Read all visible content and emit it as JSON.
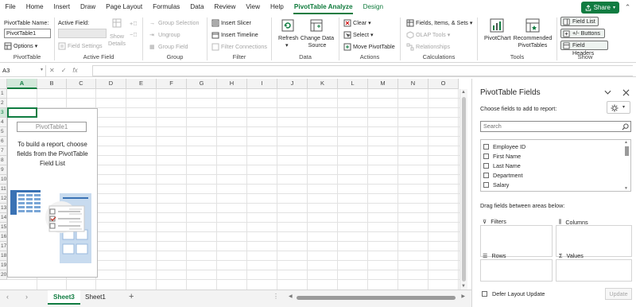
{
  "menu": {
    "tabs": [
      "File",
      "Home",
      "Insert",
      "Draw",
      "Page Layout",
      "Formulas",
      "Data",
      "Review",
      "View",
      "Help",
      "PivotTable Analyze",
      "Design"
    ],
    "active": "PivotTable Analyze",
    "share": "Share"
  },
  "ribbon": {
    "pivottable": {
      "name_label": "PivotTable Name:",
      "name_value": "PivotTable1",
      "options": "Options",
      "group": "PivotTable"
    },
    "active_field": {
      "label": "Active Field:",
      "show_details": "Show Details",
      "field_settings": "Field Settings",
      "group": "Active Field"
    },
    "group": {
      "selection": "Group Selection",
      "ungroup": "Ungroup",
      "field": "Group Field",
      "group": "Group"
    },
    "filter": {
      "slicer": "Insert Slicer",
      "timeline": "Insert Timeline",
      "connections": "Filter Connections",
      "group": "Filter"
    },
    "data": {
      "refresh": "Refresh",
      "change_source": "Change Data Source",
      "group": "Data"
    },
    "actions": {
      "clear": "Clear",
      "select": "Select",
      "move": "Move PivotTable",
      "group": "Actions"
    },
    "calculations": {
      "fields": "Fields, Items, & Sets",
      "olap": "OLAP Tools",
      "relationships": "Relationships",
      "group": "Calculations"
    },
    "tools": {
      "pivotchart": "PivotChart",
      "recommended": "Recommended PivotTables",
      "group": "Tools"
    },
    "show": {
      "field_list": "Field List",
      "buttons": "+/- Buttons",
      "headers": "Field Headers",
      "group": "Show"
    }
  },
  "formula_bar": {
    "cell": "A3",
    "cancel": "✕",
    "enter": "✓",
    "fx": "fx",
    "value": ""
  },
  "sheet": {
    "columns": [
      "A",
      "B",
      "C",
      "D",
      "E",
      "F",
      "G",
      "H",
      "I",
      "J",
      "K",
      "L",
      "M",
      "N",
      "O"
    ],
    "rows": [
      "1",
      "2",
      "3",
      "4",
      "5",
      "6",
      "7",
      "8",
      "9",
      "10",
      "11",
      "12",
      "13",
      "14",
      "15",
      "16",
      "17",
      "18",
      "19",
      "20"
    ],
    "selected_col": "A",
    "selected_row": "3",
    "pivot_name": "PivotTable1",
    "help": "To build a report, choose fields from the PivotTable Field List"
  },
  "sheet_tabs": {
    "tabs": [
      "Sheet3",
      "Sheet1"
    ],
    "active": "Sheet3",
    "add": "+"
  },
  "pane": {
    "title": "PivotTable Fields",
    "choose": "Choose fields to add to report:",
    "search_placeholder": "Search",
    "fields": [
      "Employee ID",
      "First Name",
      "Last Name",
      "Department",
      "Salary"
    ],
    "drag_label": "Drag fields between areas below:",
    "areas": {
      "filters": "Filters",
      "columns": "Columns",
      "rows": "Rows",
      "values": "Values"
    },
    "defer": "Defer Layout Update",
    "update": "Update"
  },
  "colors": {
    "accent": "#107c41",
    "accent_light": "#d2e8da",
    "header_bg": "#f3f3f3"
  }
}
